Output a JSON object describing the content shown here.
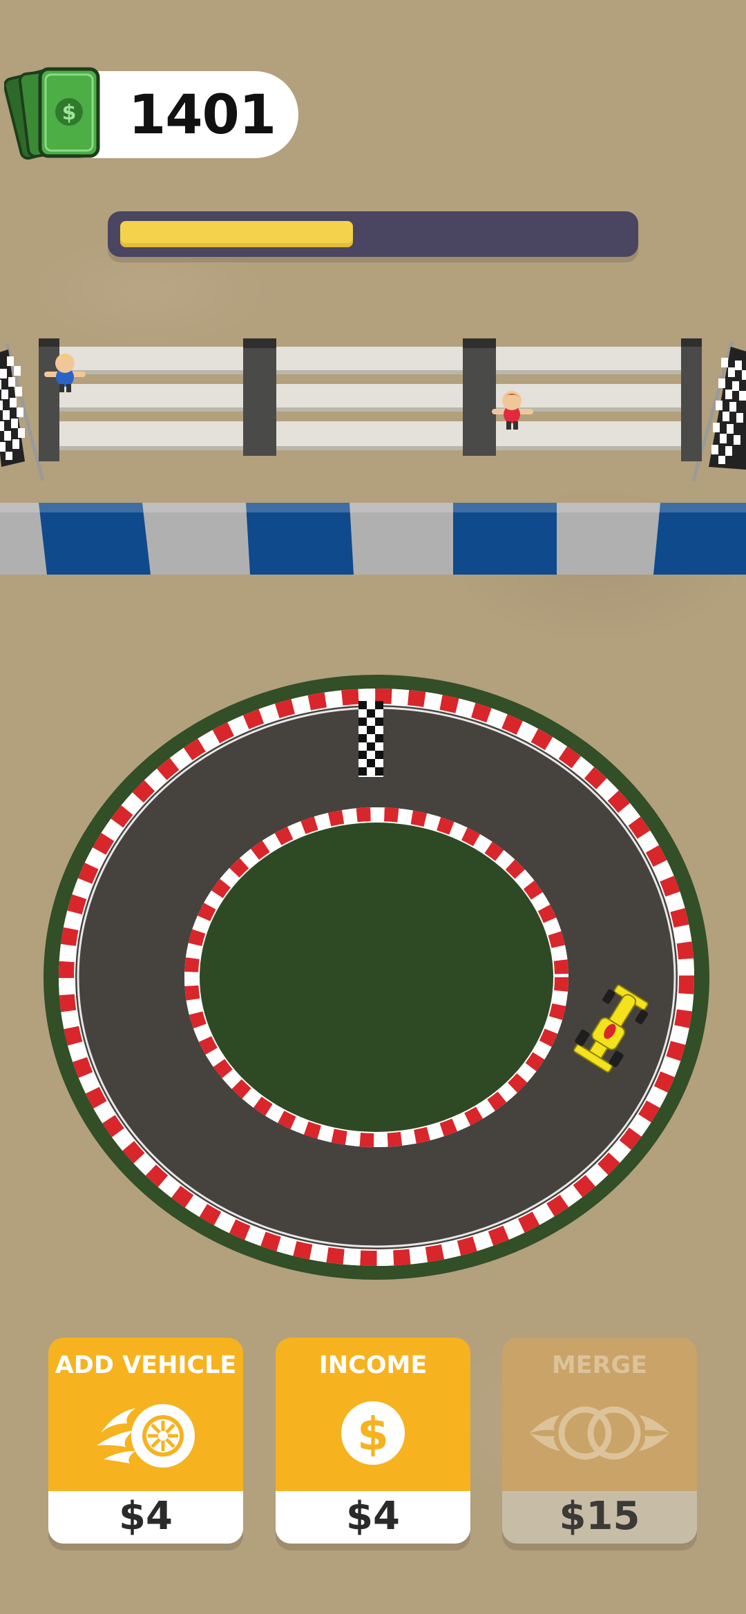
{
  "hud": {
    "money": "1401",
    "money_icon": "cash-stack-icon",
    "progress": 0.46
  },
  "scene": {
    "stands": "spectator-stands",
    "barrier_colors": [
      "#b0b0b0",
      "#0f4a8c"
    ],
    "track_colors": {
      "asphalt": "#46433f",
      "infield": "#2e4a24",
      "curb_red": "#d9262b",
      "curb_white": "#ffffff"
    },
    "car_color": "#f3e21c"
  },
  "actions": [
    {
      "title": "ADD VEHICLE",
      "price": "$4",
      "icon": "flaming-tire-icon",
      "enabled": true
    },
    {
      "title": "INCOME",
      "price": "$4",
      "icon": "dollar-coin-icon",
      "enabled": true
    },
    {
      "title": "MERGE",
      "price": "$15",
      "icon": "merge-rings-icon",
      "enabled": false
    }
  ]
}
